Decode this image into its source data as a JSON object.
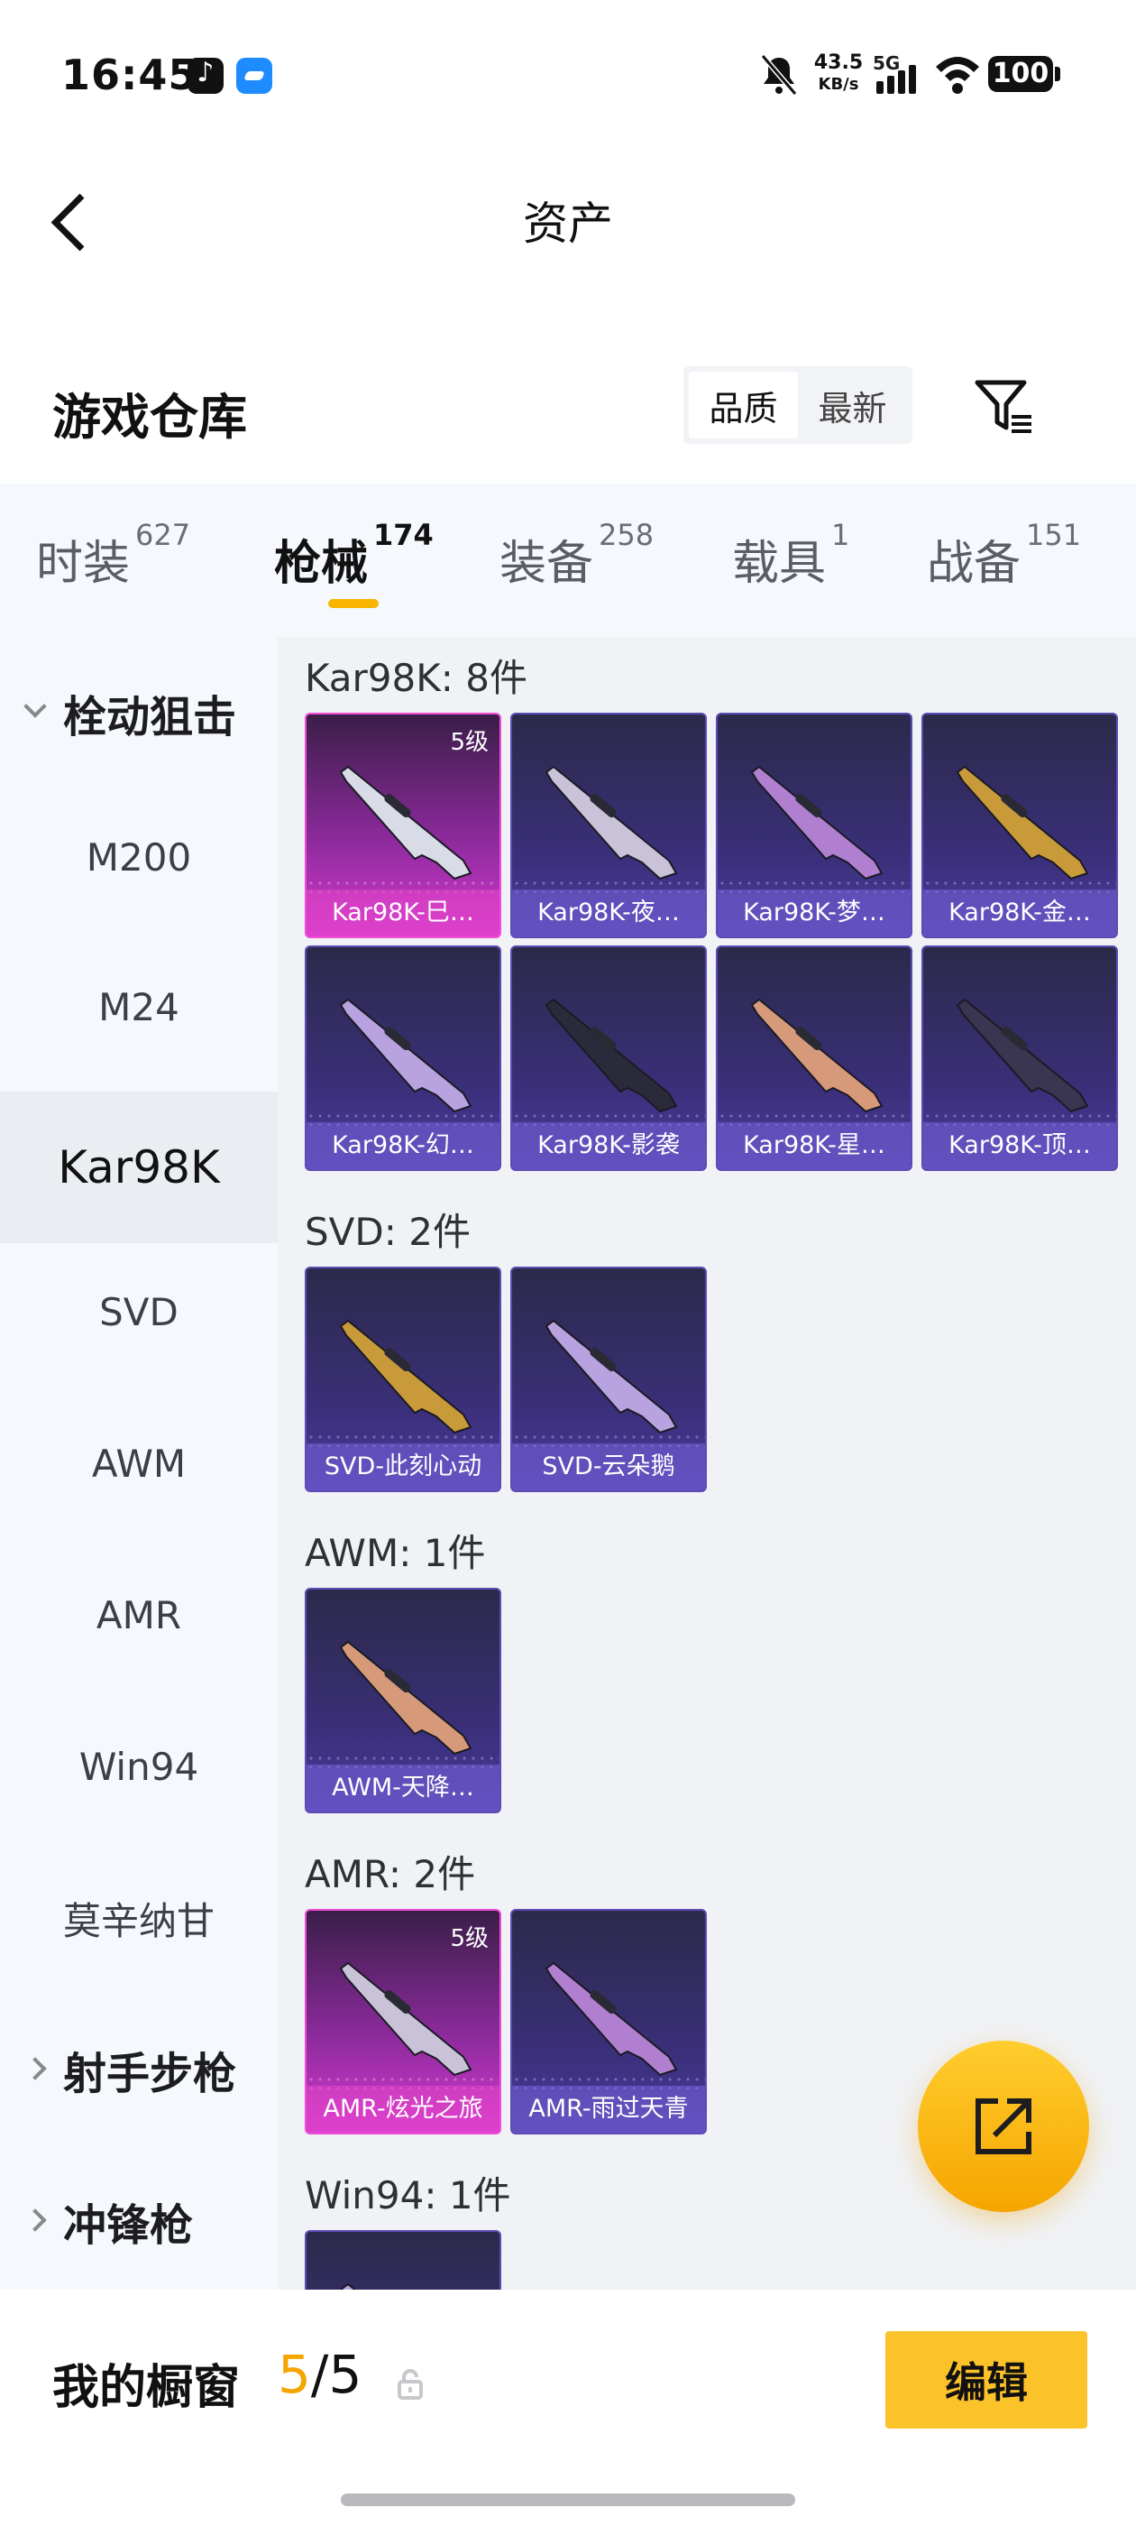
{
  "status": {
    "time": "16:45",
    "net_speed_value": "43.5",
    "net_speed_unit": "KB/s",
    "network_type": "5G",
    "battery": "100"
  },
  "header": {
    "title": "资产"
  },
  "section": {
    "title": "游戏仓库",
    "sort_options": [
      "品质",
      "最新"
    ],
    "sort_active": "品质"
  },
  "tabs": [
    {
      "label": "时装",
      "count": "627"
    },
    {
      "label": "枪械",
      "count": "174"
    },
    {
      "label": "装备",
      "count": "258"
    },
    {
      "label": "载具",
      "count": "1"
    },
    {
      "label": "战备",
      "count": "151"
    }
  ],
  "active_tab": "枪械",
  "sidebar": {
    "items": [
      {
        "label": "栓动狙击",
        "kind": "group-expanded"
      },
      {
        "label": "M200",
        "kind": "sub"
      },
      {
        "label": "M24",
        "kind": "sub"
      },
      {
        "label": "Kar98K",
        "kind": "sub-active"
      },
      {
        "label": "SVD",
        "kind": "sub"
      },
      {
        "label": "AWM",
        "kind": "sub"
      },
      {
        "label": "AMR",
        "kind": "sub"
      },
      {
        "label": "Win94",
        "kind": "sub"
      },
      {
        "label": "莫辛纳甘",
        "kind": "sub"
      },
      {
        "label": "射手步枪",
        "kind": "group-collapsed"
      },
      {
        "label": "冲锋枪",
        "kind": "group-collapsed"
      }
    ]
  },
  "groups": [
    {
      "label": "Kar98K: 8件",
      "items": [
        {
          "name": "Kar98K-巳…",
          "level": "5级",
          "rarity": "legendary"
        },
        {
          "name": "Kar98K-夜…",
          "level": "",
          "rarity": "epic"
        },
        {
          "name": "Kar98K-梦…",
          "level": "",
          "rarity": "epic"
        },
        {
          "name": "Kar98K-金…",
          "level": "",
          "rarity": "epic"
        },
        {
          "name": "Kar98K-幻…",
          "level": "",
          "rarity": "epic"
        },
        {
          "name": "Kar98K-影袭",
          "level": "",
          "rarity": "epic"
        },
        {
          "name": "Kar98K-星…",
          "level": "",
          "rarity": "epic"
        },
        {
          "name": "Kar98K-顶…",
          "level": "",
          "rarity": "epic"
        }
      ]
    },
    {
      "label": "SVD: 2件",
      "items": [
        {
          "name": "SVD-此刻心动",
          "level": "",
          "rarity": "epic"
        },
        {
          "name": "SVD-云朵鹅",
          "level": "",
          "rarity": "epic"
        }
      ]
    },
    {
      "label": "AWM: 1件",
      "items": [
        {
          "name": "AWM-天降…",
          "level": "",
          "rarity": "epic"
        }
      ]
    },
    {
      "label": "AMR: 2件",
      "items": [
        {
          "name": "AMR-炫光之旅",
          "level": "5级",
          "rarity": "legendary"
        },
        {
          "name": "AMR-雨过天青",
          "level": "",
          "rarity": "epic"
        }
      ]
    },
    {
      "label": "Win94: 1件",
      "items": [
        {
          "name": "",
          "level": "",
          "rarity": "epic"
        }
      ]
    }
  ],
  "bottom": {
    "label": "我的橱窗",
    "count_current": "5",
    "count_separator": "/",
    "count_total": "5",
    "edit_label": "编辑"
  },
  "colors": {
    "accent": "#f5a500",
    "edit_button": "#fcc22a",
    "card_epic": "#3a2f78",
    "card_legendary": "#d43ad0",
    "sidebar_bg": "#f5f8fc",
    "content_bg": "#f0f2f5"
  },
  "icons": {
    "back": "chevron-left-icon",
    "filter": "filter-icon",
    "share": "share-external-icon",
    "lock": "lock-icon",
    "mute": "bell-off-icon",
    "wifi": "wifi-icon"
  }
}
